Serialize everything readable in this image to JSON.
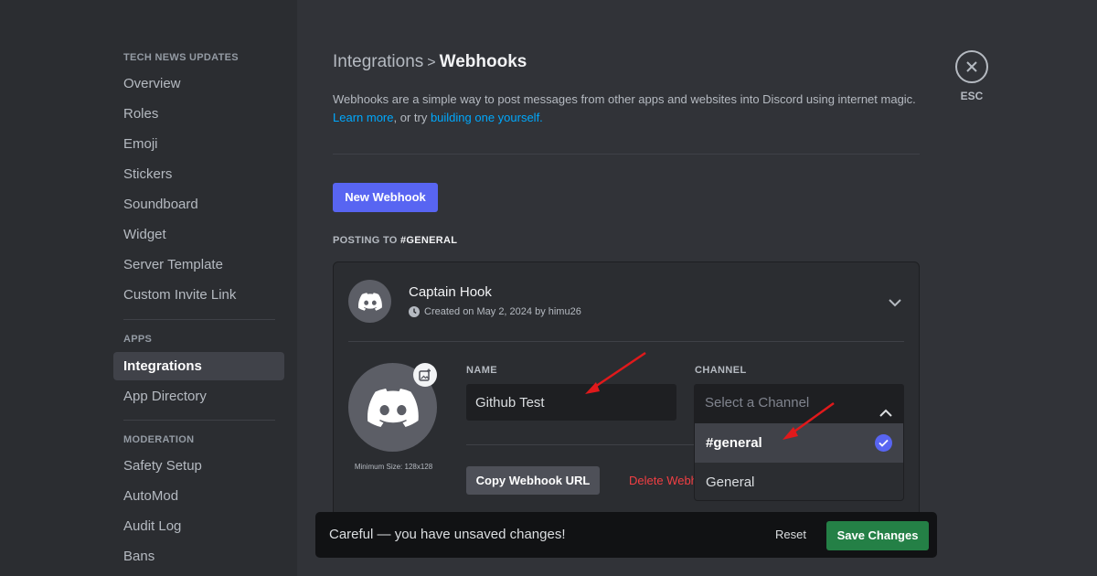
{
  "sidebar": {
    "server_header": "TECH NEWS UPDATES",
    "server_items": [
      {
        "label": "Overview"
      },
      {
        "label": "Roles"
      },
      {
        "label": "Emoji"
      },
      {
        "label": "Stickers"
      },
      {
        "label": "Soundboard"
      },
      {
        "label": "Widget"
      },
      {
        "label": "Server Template"
      },
      {
        "label": "Custom Invite Link"
      }
    ],
    "apps_header": "APPS",
    "apps_items": [
      {
        "label": "Integrations",
        "active": true
      },
      {
        "label": "App Directory"
      }
    ],
    "moderation_header": "MODERATION",
    "moderation_items": [
      {
        "label": "Safety Setup"
      },
      {
        "label": "AutoMod"
      },
      {
        "label": "Audit Log"
      },
      {
        "label": "Bans"
      }
    ]
  },
  "header": {
    "breadcrumb_parent": "Integrations",
    "breadcrumb_sep": ">",
    "breadcrumb_current": "Webhooks",
    "description": "Webhooks are a simple way to post messages from other apps and websites into Discord using internet magic.",
    "learn_more": "Learn more",
    "or_try": ", or try ",
    "build_link": "building one yourself."
  },
  "new_webhook_label": "New Webhook",
  "posting_to_prefix": "POSTING TO ",
  "posting_to_channel": "#GENERAL",
  "webhook": {
    "name": "Captain Hook",
    "created": "Created on May 2, 2024 by himu26",
    "name_label": "NAME",
    "name_value": "Github Test",
    "channel_label": "CHANNEL",
    "channel_placeholder": "Select a Channel",
    "min_size": "Minimum Size: 128x128",
    "copy_url_label": "Copy Webhook URL",
    "delete_label": "Delete Webh"
  },
  "channel_options": [
    {
      "label": "#general",
      "selected": true
    },
    {
      "label": "General",
      "selected": false
    }
  ],
  "close_label": "ESC",
  "unsaved": {
    "message": "Careful — you have unsaved changes!",
    "reset_label": "Reset",
    "save_label": "Save Changes"
  },
  "colors": {
    "accent": "#5865f2",
    "save": "#248046",
    "danger": "#f23f43",
    "link": "#00a8fc",
    "annotation_arrow": "#e0191b"
  }
}
